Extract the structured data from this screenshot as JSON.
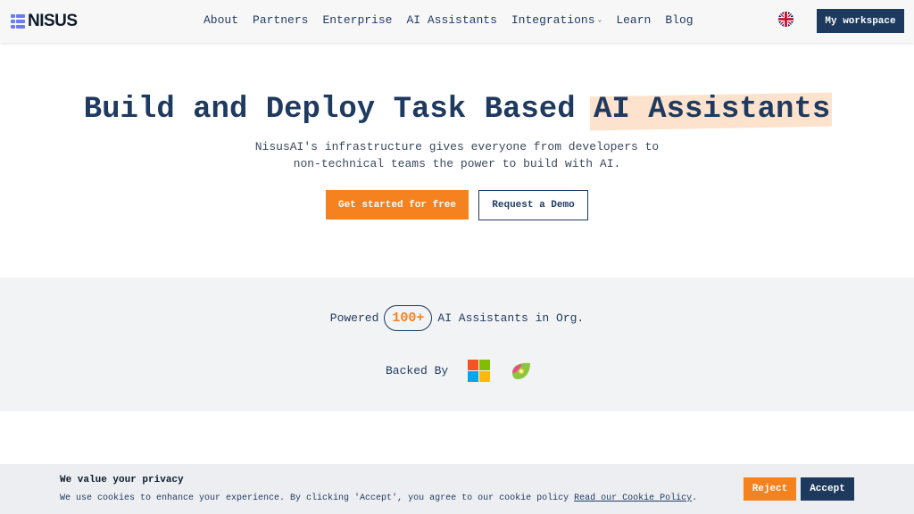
{
  "brand": {
    "name": "NISUS",
    "logo_icon": "grid-blocks-icon",
    "accent": "#f5821f",
    "primary": "#1d3a5e"
  },
  "nav": {
    "items": [
      {
        "label": "About"
      },
      {
        "label": "Partners"
      },
      {
        "label": "Enterprise"
      },
      {
        "label": "AI Assistants"
      },
      {
        "label": "Integrations",
        "icon": "chevron-down-icon"
      },
      {
        "label": "Learn"
      },
      {
        "label": "Blog"
      }
    ],
    "language_icon": "uk-flag-icon",
    "workspace_label": "My workspace"
  },
  "hero": {
    "title_main": "Build and Deploy Task Based ",
    "title_highlight": "AI Assistants",
    "subtitle_line1": "NisusAI's infrastructure gives everyone from developers to",
    "subtitle_line2": "non-technical teams the power to build with AI.",
    "cta_primary": "Get started for free",
    "cta_secondary": "Request a Demo"
  },
  "stats": {
    "prefix": "Powered",
    "count": "100+",
    "suffix": "AI Assistants in Org.",
    "backed_label": "Backed By",
    "backers": [
      "microsoft-logo-icon",
      "kiwi-leaf-logo-icon"
    ]
  },
  "cookie": {
    "title": "We value your privacy",
    "text": "We use cookies to enhance your experience. By clicking 'Accept', you agree to our cookie policy ",
    "link": "Read our Cookie Policy",
    "period": ".",
    "reject_label": "Reject",
    "accept_label": "Accept"
  }
}
